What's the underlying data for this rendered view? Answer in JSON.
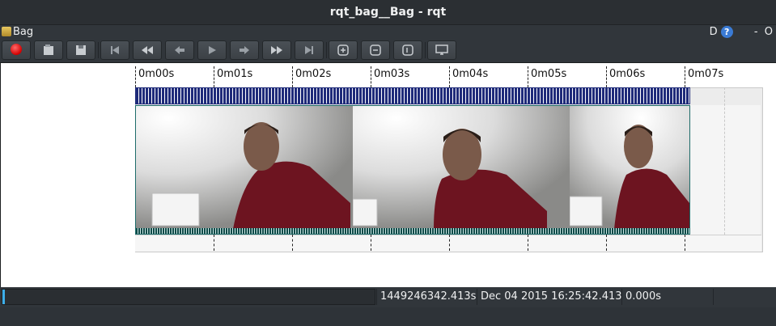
{
  "window": {
    "title": "rqt_bag__Bag - rqt"
  },
  "dock": {
    "title": "Bag",
    "right_d": "D",
    "help": "?",
    "right_dash": "-",
    "right_o": "O"
  },
  "toolbar": {
    "buttons": [
      {
        "name": "record-button",
        "icon": "record-icon"
      },
      {
        "name": "open-button",
        "icon": "open-icon"
      },
      {
        "name": "save-button",
        "icon": "save-icon"
      },
      {
        "name": "goto-begin-button",
        "icon": "skip-to-start-icon"
      },
      {
        "name": "slower-button",
        "icon": "rewind-icon"
      },
      {
        "name": "step-back-button",
        "icon": "step-back-icon"
      },
      {
        "name": "play-button",
        "icon": "play-icon"
      },
      {
        "name": "step-forward-button",
        "icon": "step-forward-icon"
      },
      {
        "name": "faster-button",
        "icon": "fast-forward-icon"
      },
      {
        "name": "goto-end-button",
        "icon": "skip-to-end-icon"
      },
      {
        "name": "zoom-in-button",
        "icon": "zoom-in-icon"
      },
      {
        "name": "zoom-out-button",
        "icon": "zoom-out-icon"
      },
      {
        "name": "zoom-all-button",
        "icon": "zoom-fit-icon"
      },
      {
        "name": "thumbnails-button",
        "icon": "thumbnail-icon"
      }
    ]
  },
  "timeline": {
    "ticks": [
      "0m00s",
      "0m01s",
      "0m02s",
      "0m03s",
      "0m04s",
      "0m05s",
      "0m06s",
      "0m07s"
    ],
    "colors": {
      "message_strip": "#1f2b7a",
      "thumbnail_border": "#1e6c6a"
    }
  },
  "status": {
    "progress": 0.0,
    "timestamp": "1449246342.413s",
    "datetime": "Dec 04 2015 16:25:42.413",
    "elapsed": "0.000s"
  }
}
